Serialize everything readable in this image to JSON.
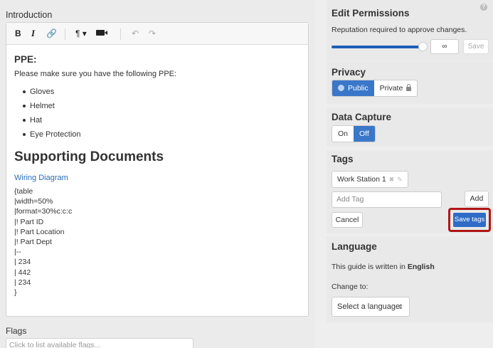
{
  "left": {
    "intro_label": "Introduction",
    "toolbar": {
      "bold": "B",
      "italic": "I",
      "link": "🔗",
      "paragraph": "¶ ▾",
      "undo": "↶",
      "redo": "↷"
    },
    "content": {
      "h_ppe": "PPE:",
      "ppe_intro": "Please make sure you have the following PPE:",
      "ppe_items": [
        "Gloves",
        "Helmet",
        "Hat",
        "Eye Protection"
      ],
      "h_docs": "Supporting Documents",
      "wiring_link": "Wiring Diagram",
      "code_lines": [
        "{table",
        "|width=50%",
        "|format=30%c:c:c",
        "|! Part ID",
        "|! Part Location",
        "|! Part Dept",
        "|--",
        "| 234",
        "| 442",
        "| 234",
        "}"
      ]
    },
    "flags_label": "Flags",
    "flags_placeholder": "Click to list available flags..."
  },
  "perm": {
    "title": "Edit Permissions",
    "help": "?",
    "rep_text": "Reputation required to approve changes.",
    "slider_fraction": 0.93,
    "value": "∞",
    "save": "Save"
  },
  "privacy": {
    "title": "Privacy",
    "public": "Public",
    "private": "Private"
  },
  "data_capture": {
    "title": "Data Capture",
    "on": "On",
    "off": "Off"
  },
  "tags": {
    "title": "Tags",
    "chip": "Work Station 1",
    "chip_remove": "✖",
    "chip_edit": "✎",
    "add_placeholder": "Add Tag",
    "add": "Add",
    "cancel": "Cancel",
    "save_tags": "Save tags"
  },
  "language": {
    "title": "Language",
    "text_prefix": "This guide is written in",
    "current": "English",
    "change_to": "Change to:",
    "select": "Select a language",
    "select_arrow": "⇕"
  },
  "colors": {
    "accent": "#3a77c9",
    "highlight": "#b01616",
    "link": "#2a6db4"
  }
}
